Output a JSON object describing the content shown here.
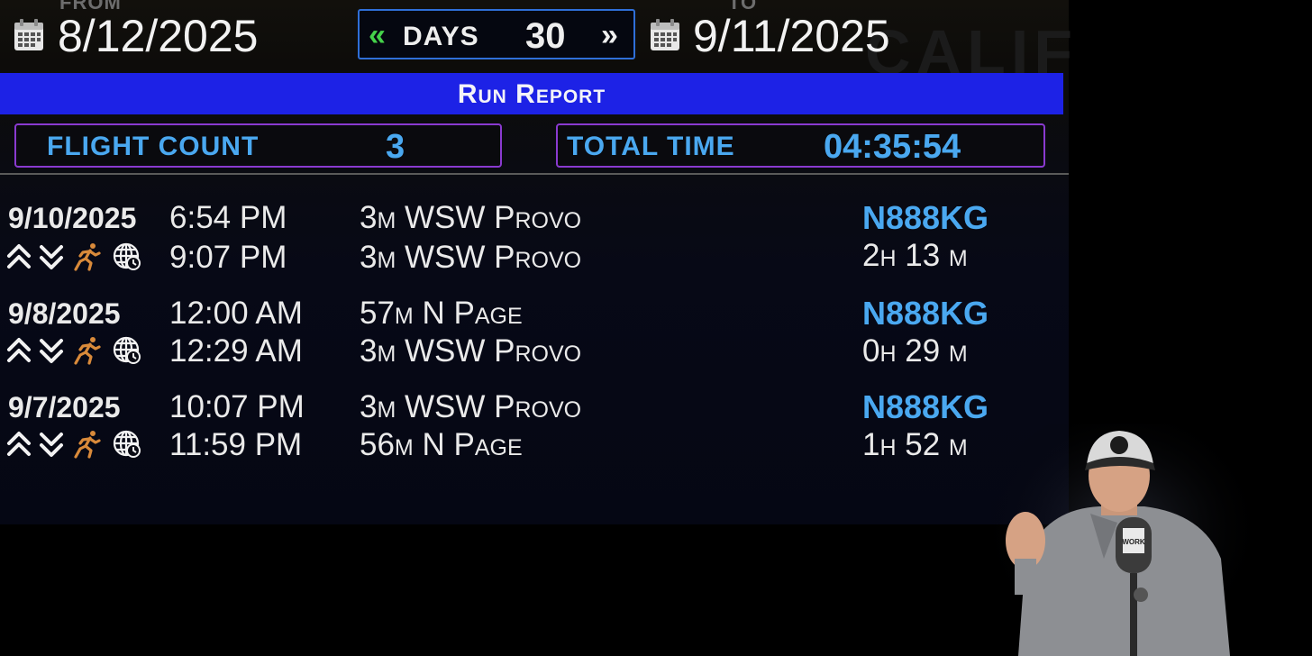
{
  "header": {
    "from_label": "FROM",
    "to_label": "TO",
    "from_date": "8/12/2025",
    "to_date": "9/11/2025",
    "days_label": "DAYS",
    "days_value": "30",
    "prev_icon": "double-chevron-left-icon",
    "next_icon": "double-chevron-right-icon",
    "calendar_icon": "calendar-icon"
  },
  "report": {
    "title": "Run Report"
  },
  "stats": {
    "flight_count_label": "FLIGHT COUNT",
    "flight_count_value": "3",
    "total_time_label": "TOTAL TIME",
    "total_time_value": "04:35:54"
  },
  "flights": [
    {
      "date": "9/10/2025",
      "depart_time": "6:54 PM",
      "arrive_time": "9:07 PM",
      "depart_location": "3m WSW Provo",
      "arrive_location": "3m WSW Provo",
      "tail_number": "N888KG",
      "duration": "2h 13 m"
    },
    {
      "date": "9/8/2025",
      "depart_time": "12:00 AM",
      "arrive_time": "12:29 AM",
      "depart_location": "57m N Page",
      "arrive_location": "3m WSW Provo",
      "tail_number": "N888KG",
      "duration": "0h 29 m"
    },
    {
      "date": "9/7/2025",
      "depart_time": "10:07 PM",
      "arrive_time": "11:59 PM",
      "depart_location": "3m WSW Provo",
      "arrive_location": "56m N Page",
      "tail_number": "N888KG",
      "duration": "1h 52 m"
    }
  ],
  "row_icons": [
    "takeoff-icon",
    "landing-icon",
    "runner-icon",
    "globe-clock-icon"
  ],
  "colors": {
    "accent_blue": "#4aa8f0",
    "report_bar": "#1d22e6",
    "stat_border": "#8a3ad0",
    "days_border": "#2f6fd8",
    "prev_green": "#45d24a",
    "runner_orange": "#d98a3a"
  },
  "overlay": {
    "mic_text": "WORK"
  }
}
